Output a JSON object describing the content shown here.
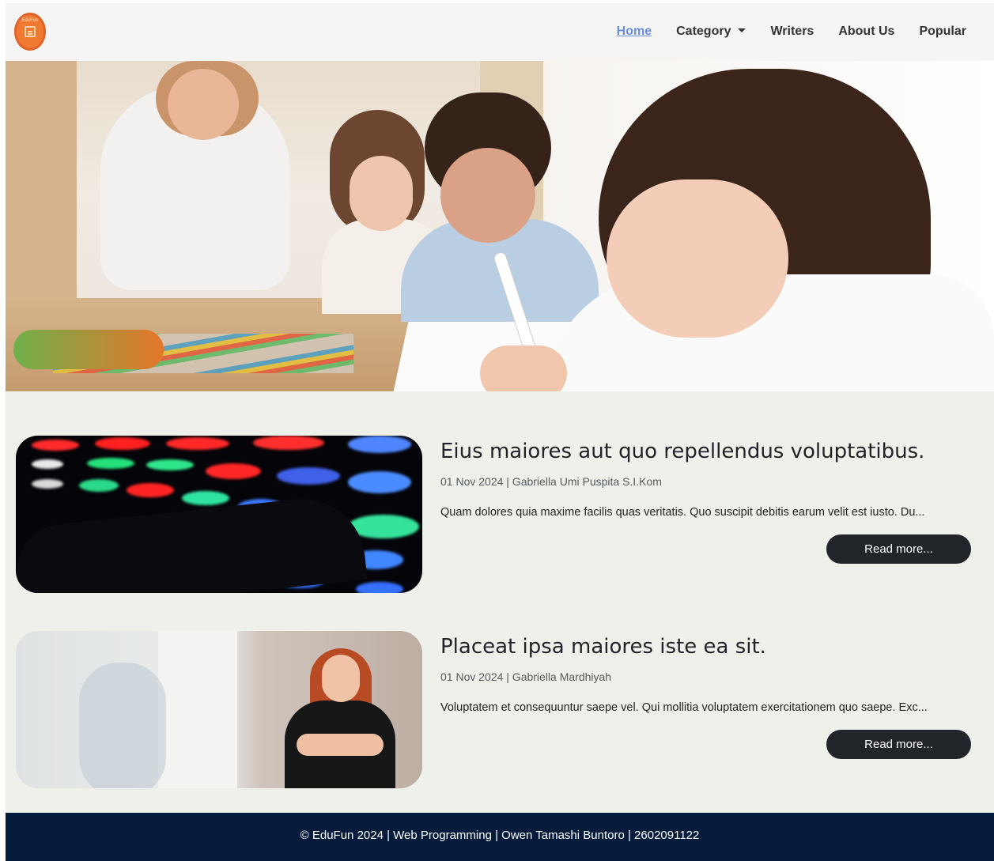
{
  "brand": {
    "logo_text": "EduFun"
  },
  "nav": {
    "items": [
      {
        "label": "Home",
        "active": true
      },
      {
        "label": "Category",
        "dropdown": true
      },
      {
        "label": "Writers"
      },
      {
        "label": "About Us"
      },
      {
        "label": "Popular"
      }
    ]
  },
  "hero": {
    "image": "classroom-children-drawing-with-teacher"
  },
  "articles": [
    {
      "title": "Eius maiores aut quo repellendus voluptatibus.",
      "meta": "01 Nov 2024 | Gabriella Umi Puspita S.I.Kom",
      "excerpt": "Quam dolores quia maxime facilis quas veritatis. Quo suscipit debitis earum velit est iusto. Du...",
      "button": "Read more...",
      "image": "colorful-light-board-hands"
    },
    {
      "title": "Placeat ipsa maiores iste ea sit.",
      "meta": "01 Nov 2024 | Gabriella Mardhiyah",
      "excerpt": "Voluptatem et consequuntur saepe vel. Qui mollitia voluptatem exercitationem quo saepe. Exc...",
      "button": "Read more...",
      "image": "smiling-woman-at-whiteboard"
    }
  ],
  "footer": {
    "text": "© EduFun 2024 | Web Programming | Owen Tamashi Buntoro | 2602091122"
  },
  "colors": {
    "nav_active": "#6e8ed3",
    "button": "#212529",
    "footer": "#041b3c",
    "page_bg": "#eef0ea"
  }
}
